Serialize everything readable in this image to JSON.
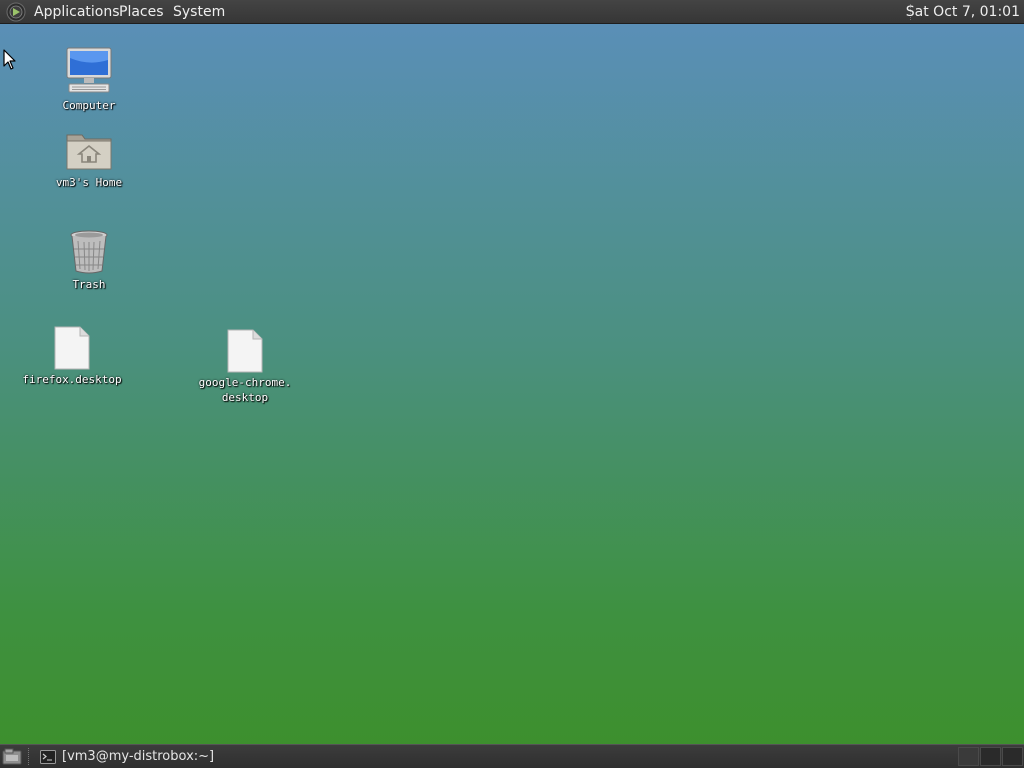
{
  "top_panel": {
    "menus": {
      "applications": "Applications",
      "places": "Places",
      "system": "System"
    },
    "clock": "Sat Oct  7, 01:01",
    "logo_icon": "gnome-foot-icon"
  },
  "desktop": {
    "background_top": "#5b8fbb",
    "background_bottom": "#3d8f2a",
    "icons": [
      {
        "label": "Computer",
        "icon": "computer-icon"
      },
      {
        "label": "vm3's Home",
        "icon": "home-folder-icon"
      },
      {
        "label": "Trash",
        "icon": "trash-icon"
      },
      {
        "label": "firefox.desktop",
        "icon": "file-icon"
      },
      {
        "label": "google-chrome.\ndesktop",
        "icon": "file-icon"
      }
    ]
  },
  "bottom_panel": {
    "show_desktop_icon": "show-desktop-icon",
    "tasks": [
      {
        "label": "[vm3@my-distrobox:~]",
        "icon": "terminal-icon"
      }
    ],
    "workspaces": 3
  }
}
